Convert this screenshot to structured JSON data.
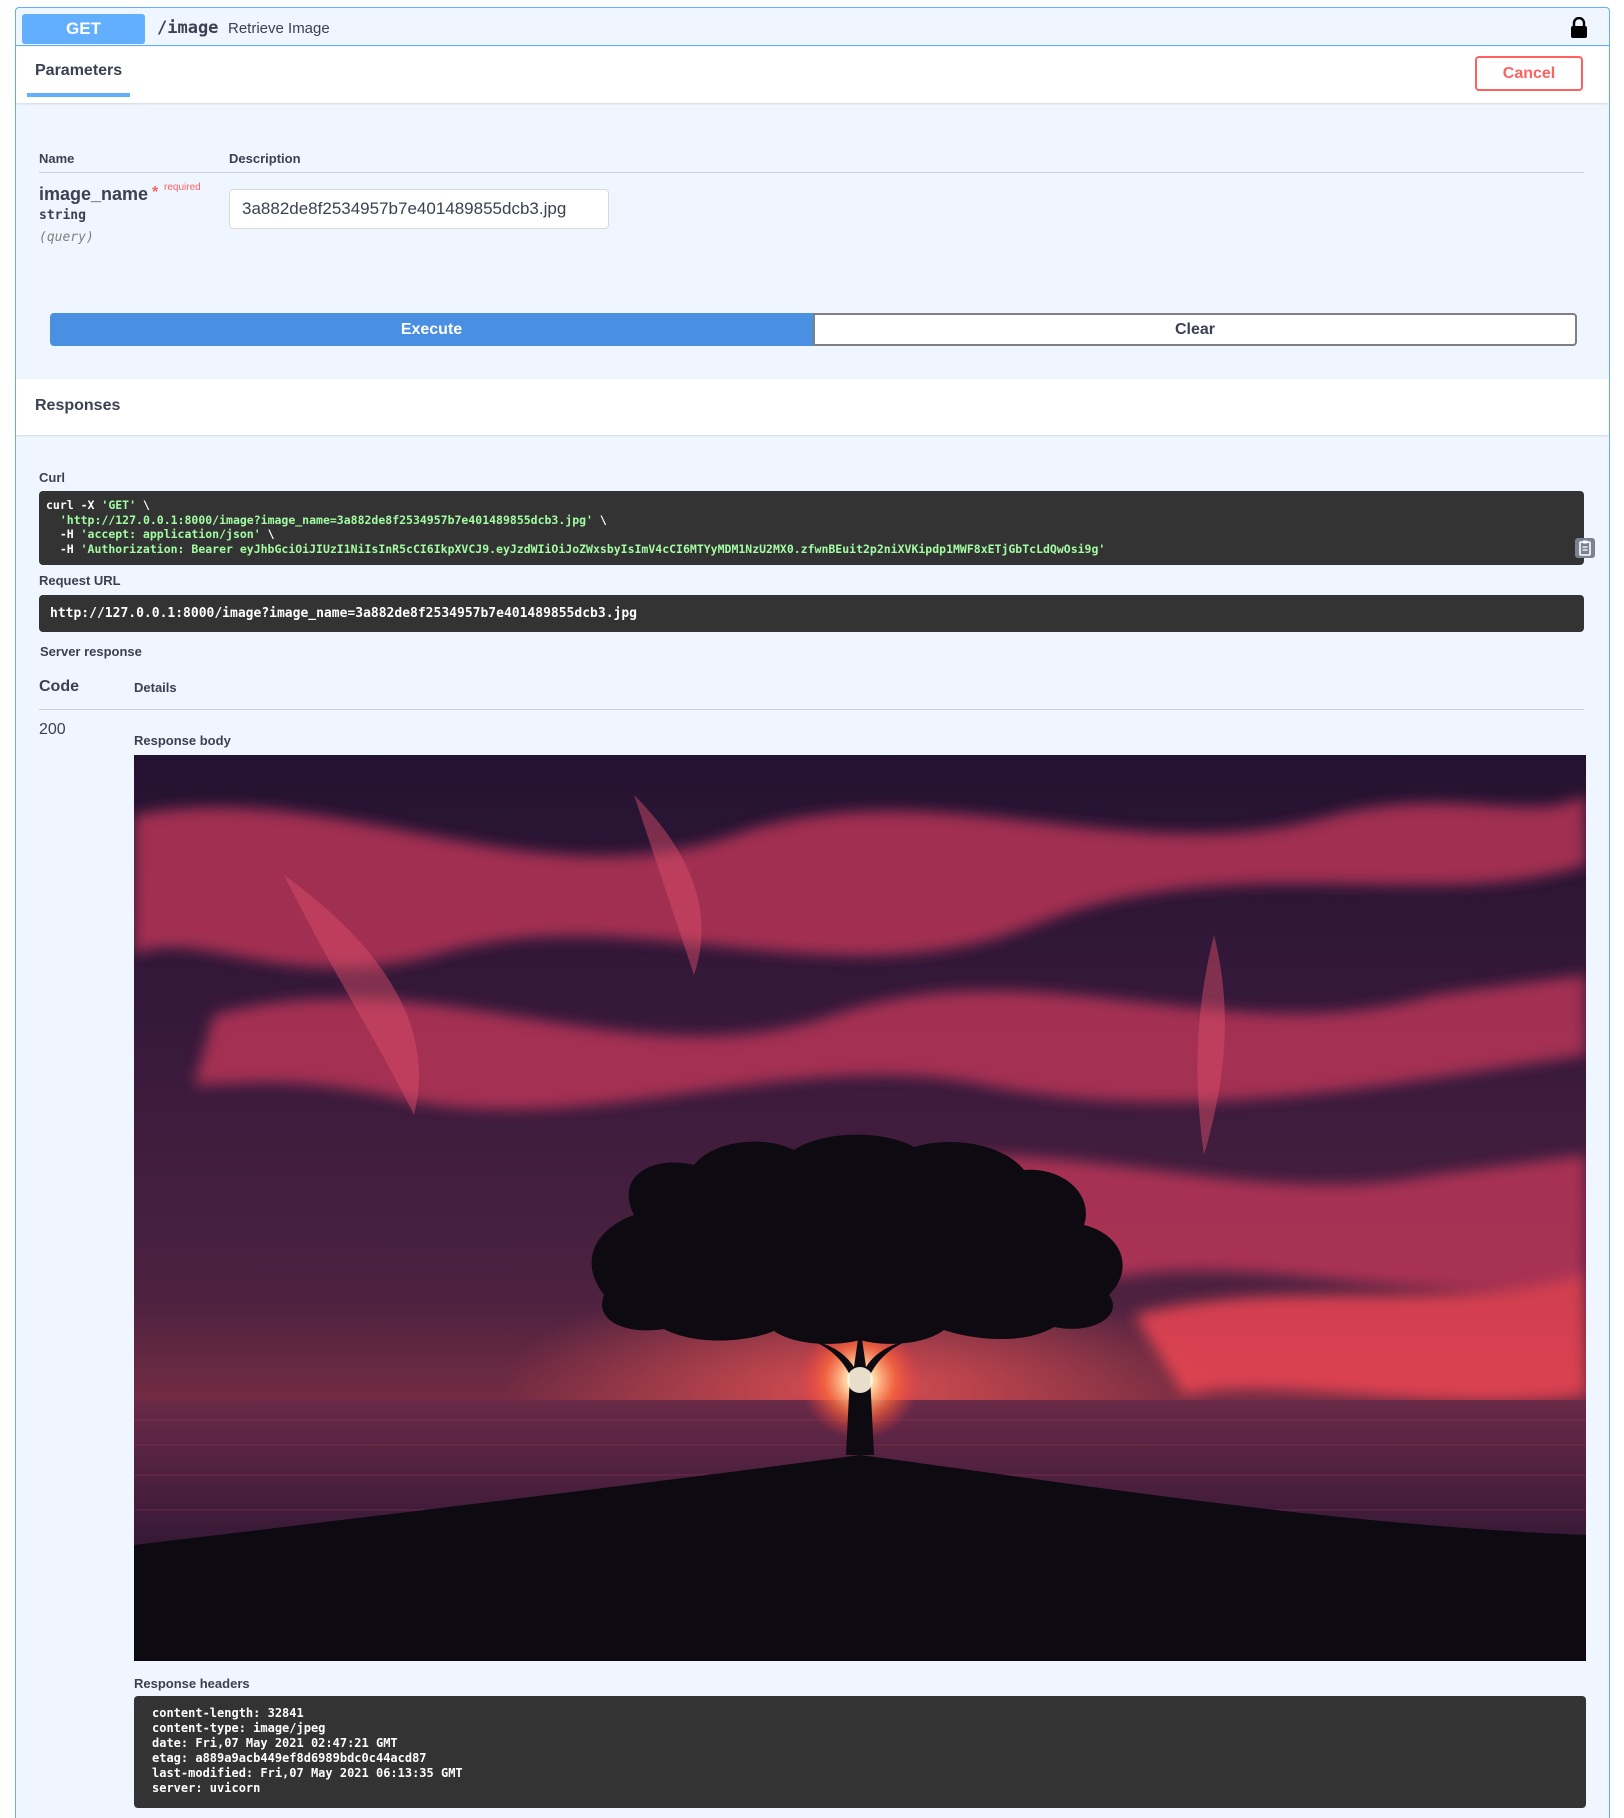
{
  "summary": {
    "method": "GET",
    "path": "/image",
    "description": "Retrieve Image",
    "lock_icon": "lock-icon"
  },
  "parameters": {
    "tab_label": "Parameters",
    "cancel_label": "Cancel",
    "col_name": "Name",
    "col_description": "Description",
    "param_name": "image_name",
    "required_star": "*",
    "required_label": "required",
    "param_type": "string",
    "param_in": "(query)",
    "param_value": "3a882de8f2534957b7e401489855dcb3.jpg"
  },
  "actions": {
    "execute_label": "Execute",
    "clear_label": "Clear"
  },
  "responses": {
    "title": "Responses",
    "curl_label": "Curl",
    "curl_lines": [
      {
        "plain": "curl -X ",
        "str": "'GET'",
        "tail": " \\"
      },
      {
        "plain": "  ",
        "str": "'http://127.0.0.1:8000/image?image_name=3a882de8f2534957b7e401489855dcb3.jpg'",
        "tail": " \\"
      },
      {
        "plain": "  -H ",
        "str": "'accept: application/json'",
        "tail": " \\"
      },
      {
        "plain": "  -H ",
        "str": "'Authorization: Bearer eyJhbGciOiJIUzI1NiIsInR5cCI6IkpXVCJ9.eyJzdWIiOiJoZWxsbyIsImV4cCI6MTYyMDM1NzU2MX0.zfwnBEuit2p2niXVKipdp1MWF8xETjGbTcLdQwOsi9g'",
        "tail": ""
      }
    ],
    "request_url_label": "Request URL",
    "request_url": "http://127.0.0.1:8000/image?image_name=3a882de8f2534957b7e401489855dcb3.jpg",
    "server_response_label": "Server response",
    "col_code": "Code",
    "col_details": "Details",
    "status_code": "200",
    "body_label": "Response body",
    "headers_label": "Response headers",
    "headers": [
      "content-length: 32841",
      "content-type: image/jpeg",
      "date: Fri,07 May 2021 02:47:21 GMT",
      "etag: a889a9acb449ef8d6989bdc0c44acd87",
      "last-modified: Fri,07 May 2021 06:13:35 GMT",
      "server: uvicorn"
    ]
  },
  "colors": {
    "get_blue": "#61affe",
    "execute_blue": "#4990e2",
    "cancel_red": "#ff6060",
    "code_bg": "#333333",
    "code_string": "#a2fca2"
  }
}
